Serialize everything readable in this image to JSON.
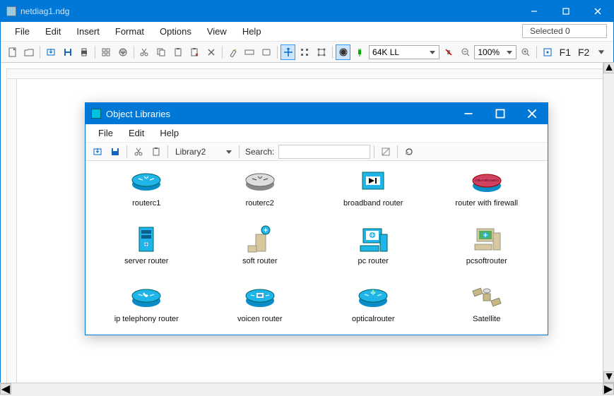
{
  "main": {
    "title": "netdiag1.ndg",
    "status": "Selected 0",
    "menu": [
      "File",
      "Edit",
      "Insert",
      "Format",
      "Options",
      "View",
      "Help"
    ],
    "zoom_combo": "64K LL",
    "percent_combo": "100%",
    "f1": "F1",
    "f2": "F2"
  },
  "dialog": {
    "title": "Object Libraries",
    "menu": [
      "File",
      "Edit",
      "Help"
    ],
    "library_combo": "Library2",
    "search_label": "Search:",
    "search_value": "",
    "items": [
      "routerc1",
      "routerc2",
      "broadband router",
      "router with firewall",
      "server router",
      "soft router",
      "pc router",
      "pcsoftrouter",
      "ip telephony router",
      "voicen router",
      "opticalrouter",
      "Satellite"
    ]
  }
}
